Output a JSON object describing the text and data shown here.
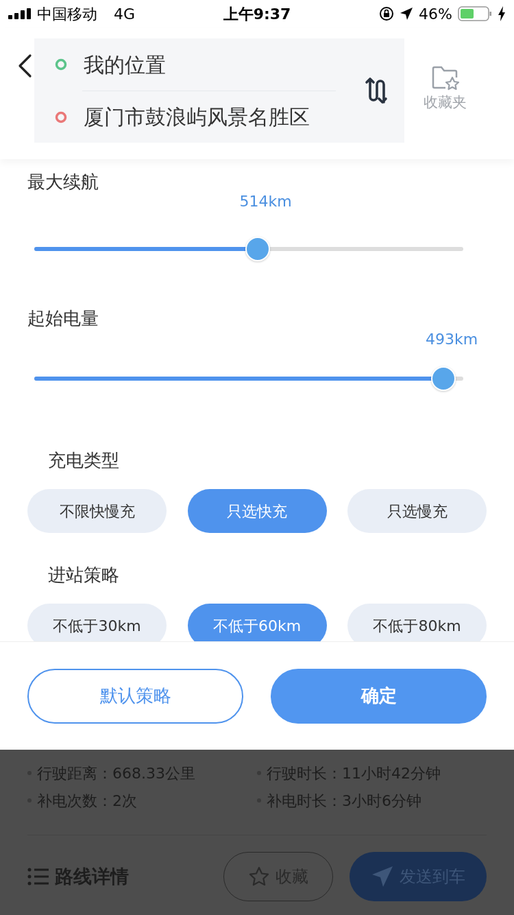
{
  "status_bar": {
    "carrier": "中国移动",
    "network": "4G",
    "time": "上午9:37",
    "battery": "46%"
  },
  "route": {
    "origin": "我的位置",
    "destination": "厦门市鼓浪屿风景名胜区",
    "favorites_label": "收藏夹"
  },
  "sliders": [
    {
      "label": "最大续航",
      "reading": "514km",
      "level": 0.52
    },
    {
      "label": "起始电量",
      "reading": "493km",
      "level": 0.954
    }
  ],
  "option_groups": [
    {
      "title": "充电类型",
      "options": [
        {
          "label": "不限快慢充",
          "selected": false
        },
        {
          "label": "只选快充",
          "selected": true
        },
        {
          "label": "只选慢充",
          "selected": false
        }
      ]
    },
    {
      "title": "进站策略",
      "options": [
        {
          "label": "不低于30km",
          "selected": false
        },
        {
          "label": "不低于60km",
          "selected": true
        },
        {
          "label": "不低于80km",
          "selected": false
        }
      ]
    }
  ],
  "footer_buttons": [
    {
      "label": "默认策略",
      "kind": "outline"
    },
    {
      "label": "确定",
      "kind": "primary"
    }
  ],
  "summary": [
    "行驶距离：668.33公里",
    "行驶时长：11小时42分钟",
    "补电次数：2次",
    "补电时长：3小时6分钟"
  ],
  "route_details_label": "路线详情",
  "actions": [
    {
      "label": "收藏",
      "kind": "outline"
    },
    {
      "label": "发送到车",
      "kind": "primary"
    }
  ]
}
